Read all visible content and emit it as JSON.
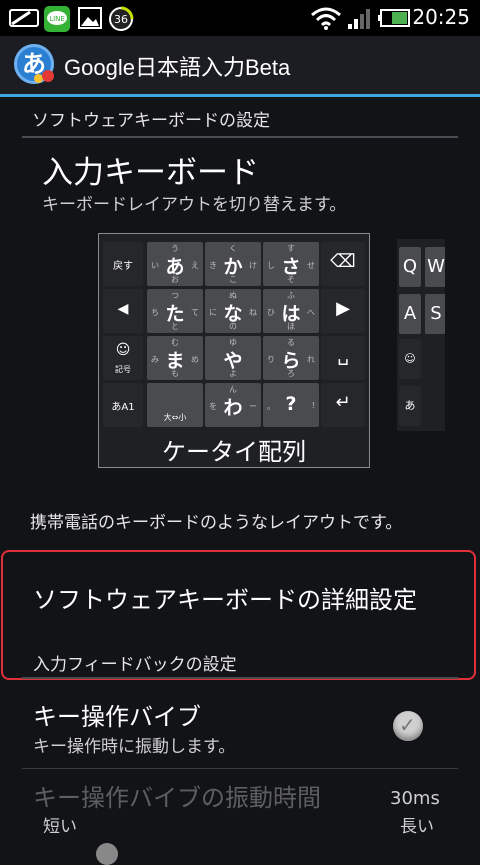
{
  "status_bar": {
    "time": "20:25",
    "notification_badge": "36",
    "icons": [
      "mail-icon",
      "line-app-icon",
      "image-icon",
      "badge-36-icon",
      "wifi-icon",
      "signal-icon",
      "battery-icon"
    ]
  },
  "action_bar": {
    "app_icon_glyph": "あ",
    "title": "Google日本語入力Beta"
  },
  "sections": {
    "software_keyboard_header": "ソフトウェアキーボードの設定",
    "input_keyboard": {
      "title": "入力キーボード",
      "subtitle": "キーボードレイアウトを切り替えます。",
      "layout_name": "ケータイ配列",
      "description": "携帯電話のキーボードのようなレイアウトです。"
    },
    "advanced_settings": "ソフトウェアキーボードの詳細設定",
    "feedback_header": "入力フィードバックの設定",
    "vibration": {
      "title": "キー操作バイブ",
      "subtitle": "キー操作時に振動します。",
      "checked": true
    },
    "vibration_duration": {
      "title": "キー操作バイブの振動時間",
      "value": "30ms",
      "min_label": "短い",
      "max_label": "長い"
    }
  },
  "keyboard_preview": {
    "fn_left": [
      "戻す",
      "◀",
      "☺",
      "あA1"
    ],
    "fn_left_sub": [
      "",
      "",
      "記号",
      ""
    ],
    "fn_right": [
      "⌫",
      "▶",
      "␣",
      "↵"
    ],
    "rows": [
      [
        {
          "main": "あ",
          "t": "う",
          "b": "お",
          "l": "い",
          "r": "え"
        },
        {
          "main": "か",
          "t": "く",
          "b": "こ",
          "l": "き",
          "r": "け"
        },
        {
          "main": "さ",
          "t": "す",
          "b": "そ",
          "l": "し",
          "r": "せ"
        }
      ],
      [
        {
          "main": "た",
          "t": "つ",
          "b": "と",
          "l": "ち",
          "r": "て"
        },
        {
          "main": "な",
          "t": "ぬ",
          "b": "の",
          "l": "に",
          "r": "ね"
        },
        {
          "main": "は",
          "t": "ふ",
          "b": "ほ",
          "l": "ひ",
          "r": "へ"
        }
      ],
      [
        {
          "main": "ま",
          "t": "む",
          "b": "も",
          "l": "み",
          "r": "め"
        },
        {
          "main": "や",
          "t": "ゆ",
          "b": "よ",
          "l": "",
          "r": ""
        },
        {
          "main": "ら",
          "t": "る",
          "b": "ろ",
          "l": "り",
          "r": "れ"
        }
      ],
      [
        {
          "main": "",
          "t": "",
          "b": "大⇔小",
          "l": "",
          "r": ""
        },
        {
          "main": "わ",
          "t": "ん",
          "b": "",
          "l": "を",
          "r": "ー"
        },
        {
          "main": "?",
          "t": "",
          "b": "",
          "l": "。",
          "r": "!"
        }
      ]
    ],
    "second_preview_keys": [
      "Q",
      "W",
      "A",
      "S",
      "☺",
      "あ"
    ]
  }
}
